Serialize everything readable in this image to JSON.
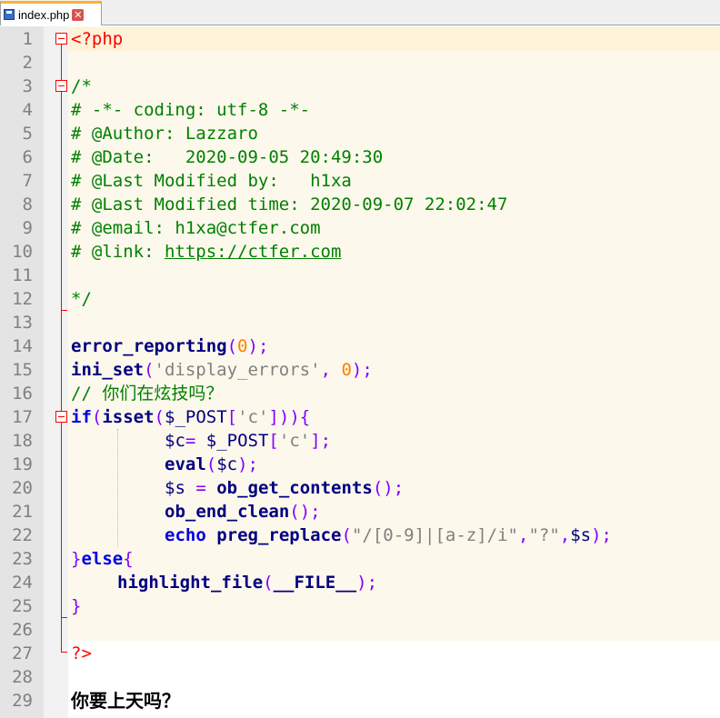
{
  "tab": {
    "filename": "index.php",
    "close_glyph": "✕"
  },
  "line_numbers": [
    "1",
    "2",
    "3",
    "4",
    "5",
    "6",
    "7",
    "8",
    "9",
    "10",
    "11",
    "12",
    "13",
    "14",
    "15",
    "16",
    "17",
    "18",
    "19",
    "20",
    "21",
    "22",
    "23",
    "24",
    "25",
    "26",
    "27",
    "28",
    "29"
  ],
  "code": {
    "l1": "<?php",
    "l3": "/*",
    "l4": "# -*- coding: utf-8 -*-",
    "l5": "# @Author: Lazzaro",
    "l6": "# @Date:   2020-09-05 20:49:30",
    "l7": "# @Last Modified by:   h1xa",
    "l8": "# @Last Modified time: 2020-09-07 22:02:47",
    "l9": "# @email: h1xa@ctfer.com",
    "l10_prefix": "# @link: ",
    "l10_link": "https://ctfer.com",
    "l12": "*/",
    "l14_fn": "error_reporting",
    "l14_open": "(",
    "l14_num": "0",
    "l14_close": ");",
    "l15_fn": "ini_set",
    "l15_open": "(",
    "l15_str": "'display_errors'",
    "l15_comma": ", ",
    "l15_num": "0",
    "l15_close": ");",
    "l16": "// 你们在炫技吗？",
    "l17_kw": "if",
    "l17_open": "(",
    "l17_fn": "isset",
    "l17_open2": "(",
    "l17_var": "$_POST",
    "l17_br1": "[",
    "l17_str": "'c'",
    "l17_br2": "]",
    "l17_close": ")){",
    "l18_var": "$c",
    "l18_eq": "= ",
    "l18_var2": "$_POST",
    "l18_br1": "[",
    "l18_str": "'c'",
    "l18_br2": "];",
    "l19_fn": "eval",
    "l19_open": "(",
    "l19_var": "$c",
    "l19_close": ");",
    "l20_var": "$s",
    "l20_eq": " = ",
    "l20_fn": "ob_get_contents",
    "l20_close": "();",
    "l21_fn": "ob_end_clean",
    "l21_close": "();",
    "l22_kw": "echo",
    "l22_sp": " ",
    "l22_fn": "preg_replace",
    "l22_open": "(",
    "l22_str1": "\"/[0-9]|[a-z]/i\"",
    "l22_c1": ",",
    "l22_str2": "\"?\"",
    "l22_c2": ",",
    "l22_var": "$s",
    "l22_close": ");",
    "l23_brace": "}",
    "l23_kw": "else",
    "l23_open": "{",
    "l24_fn": "highlight_file",
    "l24_open": "(",
    "l24_const": "__FILE__",
    "l24_close": ");",
    "l25": "}",
    "l27": "?>"
  },
  "output_text": "你要上天吗？",
  "colors": {
    "keyword": "#0000e0",
    "php_tag": "#ff0000",
    "comment": "#008000",
    "number": "#ff8000",
    "string": "#808080",
    "operator": "#8000ff",
    "gutter": "#e4e4e4",
    "code_background": "#fdf8ec"
  }
}
